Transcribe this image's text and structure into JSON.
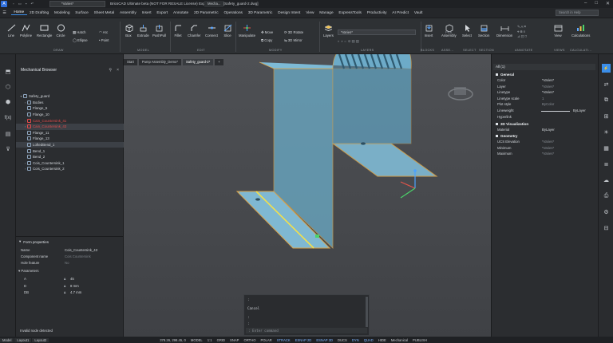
{
  "titlebar": {
    "title": "BricsCAD Ultimate beta (NOT FOR RESALE License) Experimental - [Safety_guard-2.dwg]",
    "app_badge": "A",
    "quick_access_value": "*Varies*",
    "doc_tab": "Mecha...",
    "window_buttons": [
      "–",
      "□",
      "✕"
    ]
  },
  "menubar": {
    "items": [
      "Home",
      "2D Drafting",
      "Modeling",
      "Surface",
      "Sheet Metal",
      "Assembly",
      "Insert",
      "Export",
      "Annotate",
      "2D Parametric",
      "Operations",
      "3D Parametric",
      "Design Intent",
      "View",
      "Manage",
      "ExpressTools",
      "Productivity",
      "AI Predict",
      "Vault"
    ],
    "help_search_placeholder": "Search in Help"
  },
  "ribbon": {
    "draw_tools": [
      "Line",
      "Polyline",
      "Rectangle",
      "Circle"
    ],
    "draw_small": [
      "Hatch",
      "Ellipse",
      "Arc",
      "Point"
    ],
    "model_tools": [
      "Box",
      "Extrude",
      "PushPull"
    ],
    "edit_tools": [
      "Fillet",
      "Chamfer",
      "Connect",
      "Slice"
    ],
    "modify_tools": [
      "Manipulate"
    ],
    "modify_small": [
      "Move",
      "Copy",
      "3D Rotate",
      "3D Mirror"
    ],
    "layers_tool": "Layers",
    "layer_value": "*Varies*",
    "right_tools": [
      "Insert",
      "Assembly",
      "Pick",
      "Select",
      "Section",
      "Dimension",
      "View",
      "Calculations"
    ],
    "groups": [
      "DRAW",
      "MODEL",
      "EDIT",
      "MODIFY",
      "LAYERS",
      "BLOCKS",
      "ASSE...",
      "SELECT",
      "SECTION",
      "ANNOTATE",
      "VIEWS",
      "CALCULATI..."
    ]
  },
  "browser": {
    "title": "Mechanical Browser",
    "tree": [
      {
        "label": "Safety_guard",
        "indent": 0,
        "arrow": "▾",
        "red": false,
        "sel": false
      },
      {
        "label": "Bodies",
        "indent": 1,
        "arrow": "›",
        "red": false,
        "sel": false
      },
      {
        "label": "Flange_5",
        "indent": 1,
        "arrow": "",
        "red": false,
        "sel": false
      },
      {
        "label": "Flange_10",
        "indent": 1,
        "arrow": "",
        "red": false,
        "sel": false
      },
      {
        "label": "Cain_Countersink_41",
        "indent": 1,
        "arrow": "›",
        "red": true,
        "sel": false
      },
      {
        "label": "Cain_Countersink_43",
        "indent": 1,
        "arrow": "›",
        "red": true,
        "sel": true
      },
      {
        "label": "Flange_11",
        "indent": 1,
        "arrow": "",
        "red": false,
        "sel": false
      },
      {
        "label": "Flange_13",
        "indent": 1,
        "arrow": "",
        "red": false,
        "sel": false
      },
      {
        "label": "LoftedBend_1",
        "indent": 1,
        "arrow": "",
        "red": false,
        "sel": true
      },
      {
        "label": "Bend_1",
        "indent": 1,
        "arrow": "",
        "red": false,
        "sel": false
      },
      {
        "label": "Bend_2",
        "indent": 1,
        "arrow": "",
        "red": false,
        "sel": false
      },
      {
        "label": "Cois_Countersink_1",
        "indent": 1,
        "arrow": "›",
        "red": false,
        "sel": false
      },
      {
        "label": "Cois_Countersink_2",
        "indent": 1,
        "arrow": "›",
        "red": false,
        "sel": false
      }
    ],
    "props_title": "Form properties",
    "props": [
      {
        "k": "Name",
        "v": "Cois_Countersink_43",
        "dim": false
      },
      {
        "k": "Component name",
        "v": "Cois Countersink",
        "dim": true
      },
      {
        "k": "Hole feature",
        "v": "No",
        "dim": true
      }
    ],
    "params_title": "Parameters",
    "params": [
      {
        "k": "A",
        "v": "45"
      },
      {
        "k": "D",
        "v": "8 mm"
      },
      {
        "k": "DB",
        "v": "4.7 mm"
      }
    ],
    "status": "Invalid node detected"
  },
  "viewport": {
    "tabs": [
      "Start",
      "Pump Assembly_Demo*",
      "Safety_guard-2*",
      "+"
    ],
    "active_tab": 2,
    "command_lines": [
      ":",
      "Cancel",
      ":",
      ":"
    ],
    "command_placeholder": ": Enter command"
  },
  "properties": {
    "selection": "All (1)",
    "general_title": "General",
    "general": [
      {
        "k": "Color",
        "v": "*Varies*",
        "dim": false
      },
      {
        "k": "Layer",
        "v": "*Varies*",
        "dim": true
      },
      {
        "k": "Linetype",
        "v": "*Varies*",
        "dim": false
      },
      {
        "k": "Linetype scale",
        "v": "1",
        "dim": true
      },
      {
        "k": "Plot style",
        "v": "ByColor",
        "dim": true
      },
      {
        "k": "Lineweight",
        "v": "ByLayer",
        "dim": false
      },
      {
        "k": "Hyperlink",
        "v": "",
        "dim": false
      }
    ],
    "viz_title": "3D Visualization",
    "viz": [
      {
        "k": "Material",
        "v": "ByLayer",
        "dim": false
      }
    ],
    "geom_title": "Geometry",
    "geom": [
      {
        "k": "UCS Elevation",
        "v": "*Varies*",
        "dim": true
      },
      {
        "k": "Minimum",
        "v": "*Varies*",
        "dim": true
      },
      {
        "k": "Maximum",
        "v": "*Varies*",
        "dim": true
      }
    ]
  },
  "statusbar": {
    "tabs": [
      "Model",
      "Layout1",
      "Layout2"
    ],
    "coords": "378.26, 298.45, 0",
    "items": [
      "MODEL",
      "1:1",
      "GRID",
      "SNAP",
      "ORTHO",
      "POLAR",
      "STRACK",
      "ESNAP 2D",
      "ESNAP 3D",
      "DUCS",
      "DYN",
      "QUAD",
      "HIDE",
      "Mechanical",
      "PUBLISH"
    ],
    "on_items": [
      "STRACK",
      "ESNAP 2D",
      "ESNAP 3D",
      "DYN",
      "QUAD"
    ]
  }
}
